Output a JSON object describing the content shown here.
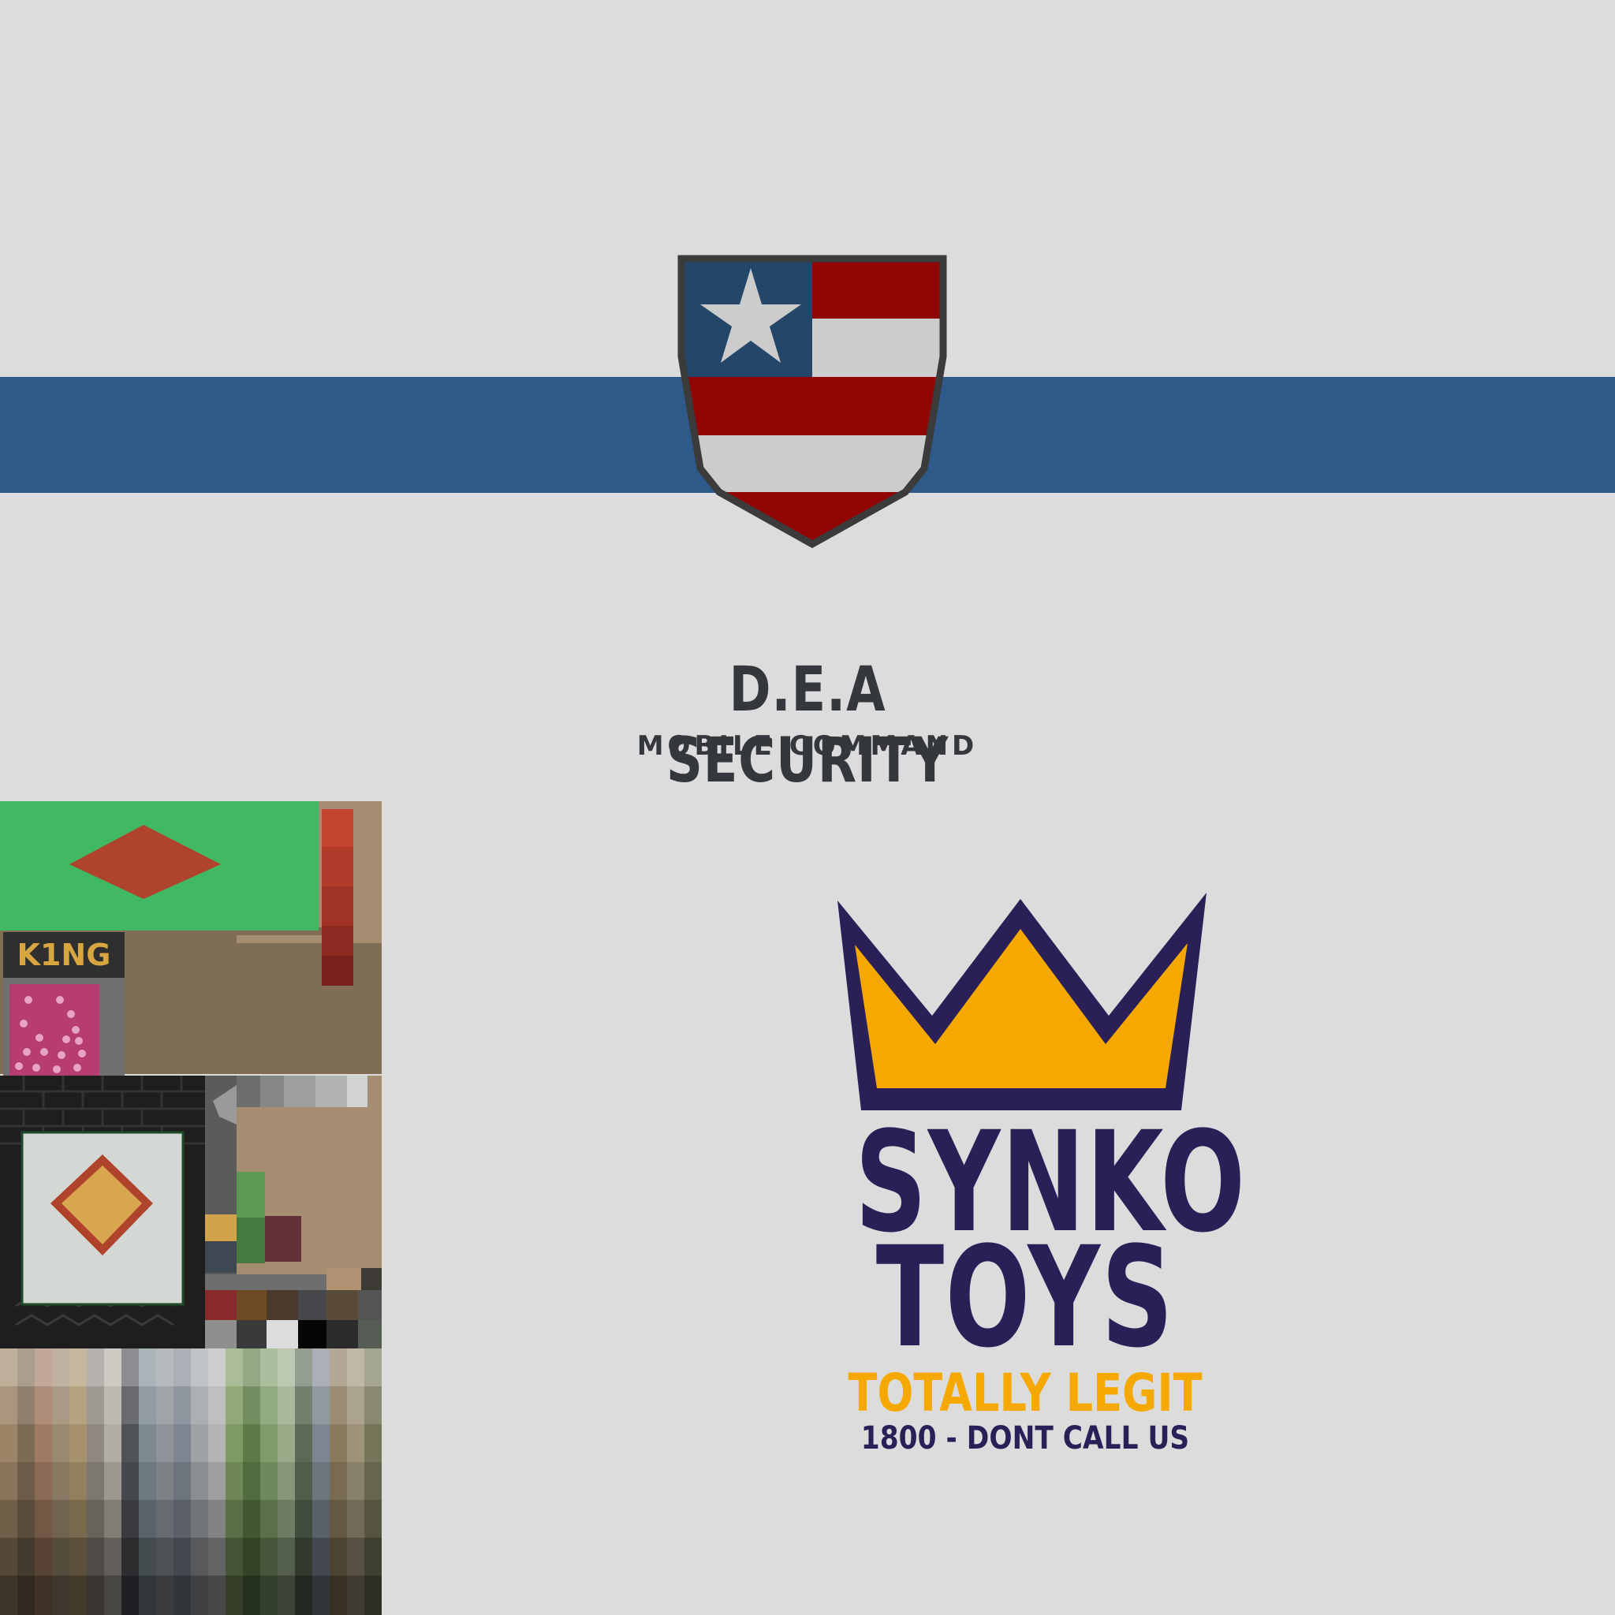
{
  "dea": {
    "title": "D.E.A SECURITY",
    "subtitle": "MOBILE COMMAND",
    "emblem": "shield-flag-icon",
    "colors": {
      "stripe": "#2e5a89",
      "red": "#920505",
      "white": "#cccccc",
      "blue": "#234669",
      "text": "#34373b"
    }
  },
  "synko": {
    "line1": "SYNKO",
    "line2": "TOYS",
    "tagline": "TOTALLY LEGIT",
    "phone": "1800 - DONT CALL US",
    "emblem": "crown-icon",
    "colors": {
      "purple": "#2a1f57",
      "gold": "#f5a900"
    }
  },
  "atlas": {
    "king_label": "K1NG",
    "colors": {
      "green": "#40b864",
      "diamond": "#b0432c",
      "tan": "#a58d71",
      "brown": "#7f6d56",
      "pink": "#b63c72"
    }
  },
  "background": "#dcdcdc"
}
